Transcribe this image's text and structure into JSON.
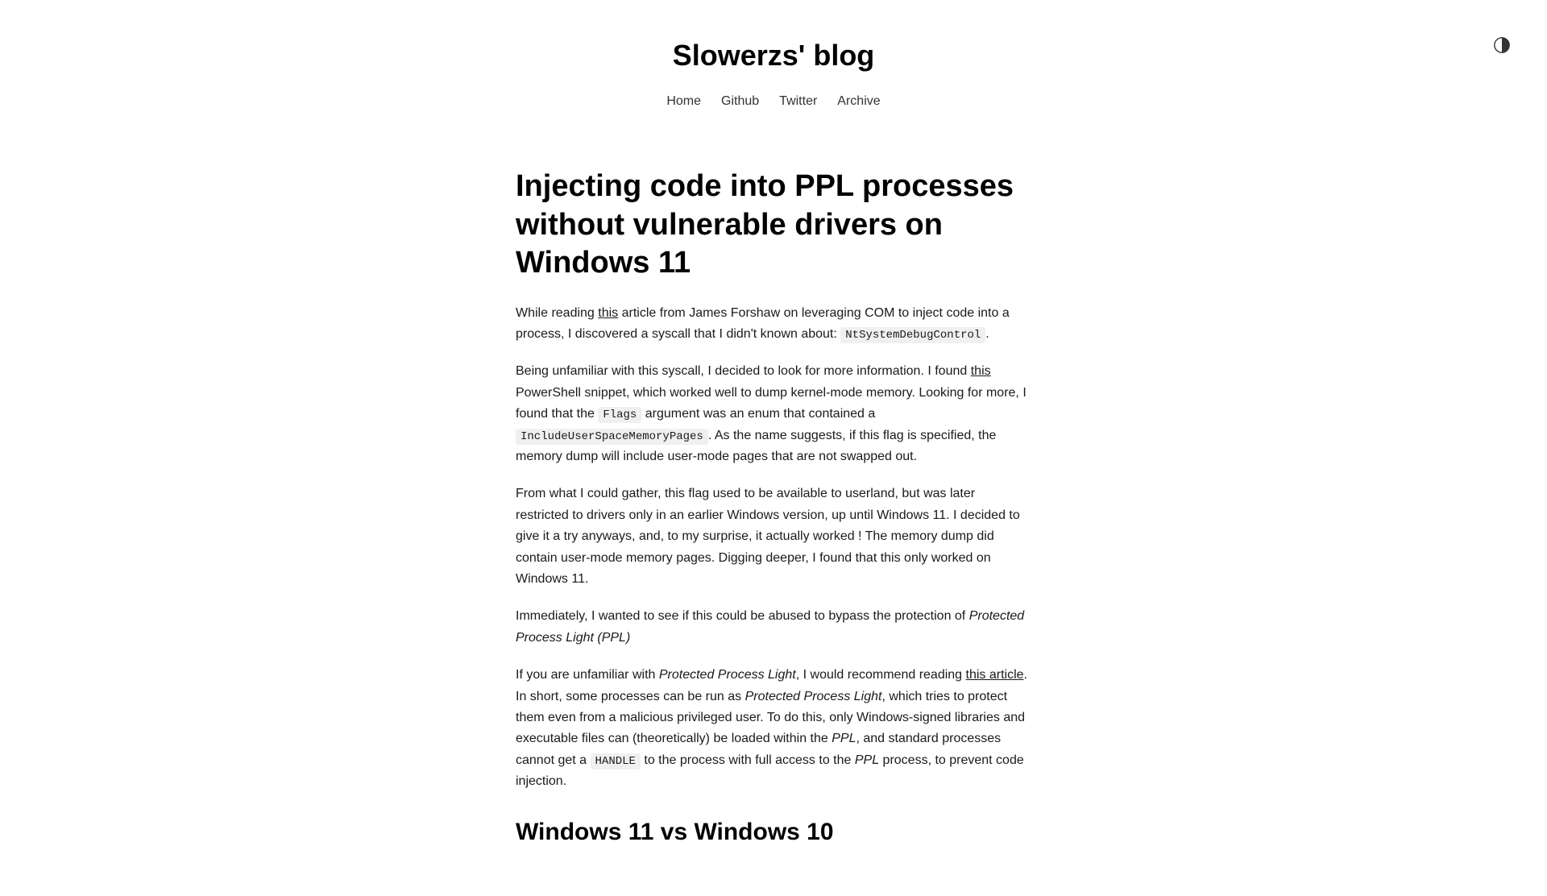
{
  "header": {
    "site_title": "Slowerzs' blog",
    "nav": {
      "home": "Home",
      "github": "Github",
      "twitter": "Twitter",
      "archive": "Archive"
    }
  },
  "article": {
    "title": "Injecting code into PPL processes without vulnerable drivers on Windows 11",
    "p1": {
      "t1": "While reading ",
      "link1": "this",
      "t2": " article from James Forshaw on leveraging COM to inject code into a process, I discovered a syscall that I didn't known about: ",
      "code1": "NtSystemDebugControl",
      "t3": "."
    },
    "p2": {
      "t1": "Being unfamiliar with this syscall, I decided to look for more information. I found ",
      "link1": "this",
      "t2": " PowerShell snippet, which worked well to dump kernel-mode memory. Looking for more, I found that the ",
      "code1": "Flags",
      "t3": " argument was an enum that contained a ",
      "code2": "IncludeUserSpaceMemoryPages",
      "t4": ". As the name suggests, if this flag is specified, the memory dump will include user-mode pages that are not swapped out."
    },
    "p3": {
      "t1": "From what I could gather, this flag used to be available to userland, but was later restricted to drivers only in an earlier Windows version, up until Windows 11. I decided to give it a try anyways, and, to my surprise, it actually worked ! The memory dump did contain user-mode memory pages. Digging deeper, I found that this only worked on Windows 11."
    },
    "p4": {
      "t1": "Immediately, I wanted to see if this could be abused to bypass the protection of ",
      "italic1": "Protected Process Light (PPL)"
    },
    "p5": {
      "t1": "If you are unfamiliar with ",
      "italic1": "Protected Process Light",
      "t2": ", I would recommend reading ",
      "link1": "this article",
      "t3": ". In short, some processes can be run as ",
      "italic2": "Protected Process Light",
      "t4": ", which tries to protect them even from a malicious privileged user. To do this, only Windows-signed libraries and executable files can (theoretically) be loaded within the ",
      "italic3": "PPL",
      "t5": ", and standard processes cannot get a ",
      "code1": "HANDLE",
      "t6": " to the process with full access to the ",
      "italic4": "PPL",
      "t7": " process, to prevent code injection."
    },
    "section_heading": "Windows 11 vs Windows 10"
  }
}
